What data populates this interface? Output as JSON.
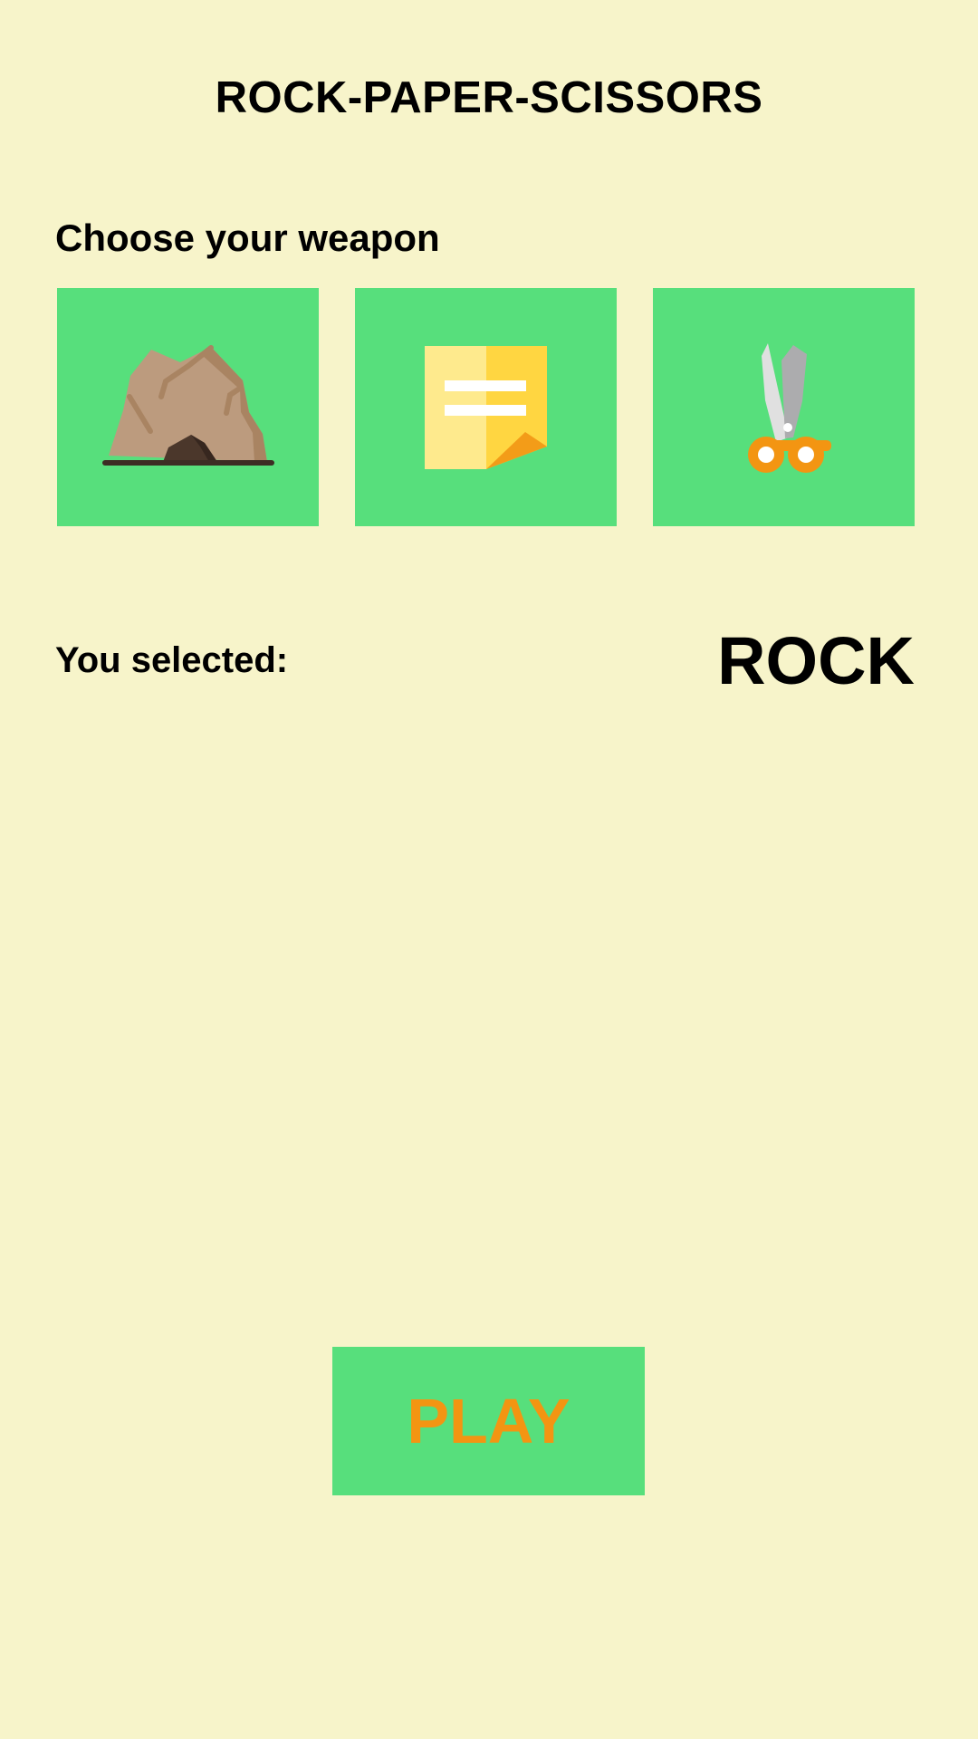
{
  "app": {
    "title": "ROCK-PAPER-SCISSORS",
    "background_color": "#f7f4ca"
  },
  "weapons": {
    "prompt": "Choose your weapon",
    "tile_color": "#57df7c",
    "items": [
      {
        "id": "rock",
        "icon": "rock-icon"
      },
      {
        "id": "paper",
        "icon": "paper-note-icon"
      },
      {
        "id": "scissors",
        "icon": "scissors-icon"
      }
    ]
  },
  "selection": {
    "label": "You selected:",
    "value": "ROCK"
  },
  "play": {
    "label": "PLAY",
    "text_color": "#f39512",
    "background_color": "#57df7c"
  }
}
